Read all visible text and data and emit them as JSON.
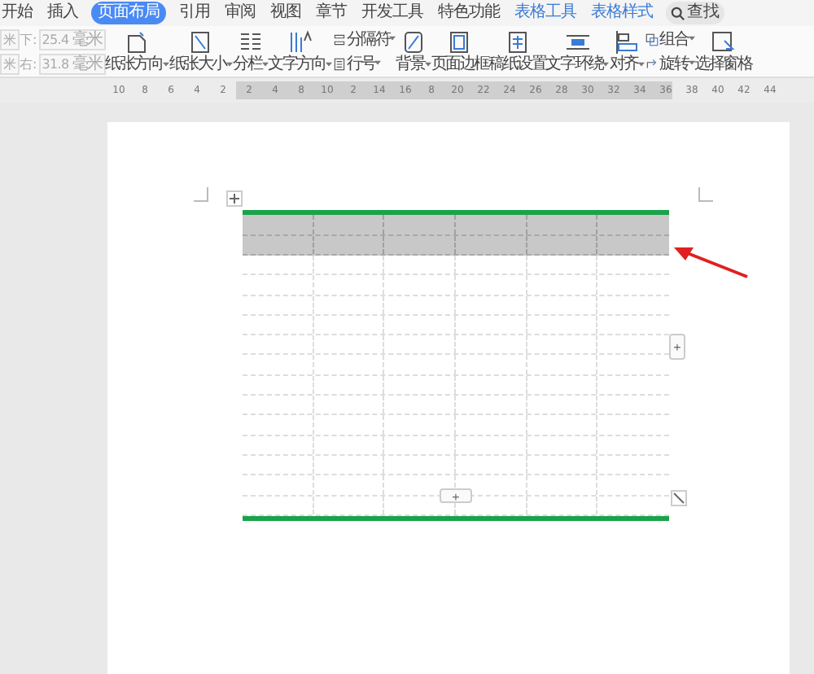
{
  "tabs": [
    {
      "label": "开始",
      "selected": false,
      "kind": "normal"
    },
    {
      "label": "插入",
      "selected": false,
      "kind": "normal"
    },
    {
      "label": "页面布局",
      "selected": true,
      "kind": "normal"
    },
    {
      "label": "引用",
      "selected": false,
      "kind": "normal"
    },
    {
      "label": "审阅",
      "selected": false,
      "kind": "normal"
    },
    {
      "label": "视图",
      "selected": false,
      "kind": "normal"
    },
    {
      "label": "章节",
      "selected": false,
      "kind": "normal"
    },
    {
      "label": "开发工具",
      "selected": false,
      "kind": "normal"
    },
    {
      "label": "特色功能",
      "selected": false,
      "kind": "normal"
    },
    {
      "label": "表格工具",
      "selected": false,
      "kind": "contextual"
    },
    {
      "label": "表格样式",
      "selected": false,
      "kind": "contextual"
    }
  ],
  "search": {
    "label": "查找"
  },
  "margin_fields": [
    {
      "value": "米"
    },
    {
      "value": "米"
    }
  ],
  "margins": [
    {
      "label": "下:",
      "value": "25.4",
      "unit": "毫米"
    },
    {
      "label": "右:",
      "value": "31.8",
      "unit": "毫米"
    }
  ],
  "ribbon": [
    {
      "kind": "big",
      "label": "纸张方向",
      "dropdown": true
    },
    {
      "kind": "big",
      "label": "纸张大小",
      "dropdown": true
    },
    {
      "kind": "big",
      "label": "分栏",
      "dropdown": true
    },
    {
      "kind": "big",
      "label": "文字方向",
      "dropdown": true
    },
    {
      "kind": "small",
      "items": [
        {
          "label": "分隔符",
          "dropdown": true
        },
        {
          "label": "行号",
          "dropdown": true
        }
      ]
    },
    {
      "kind": "big",
      "label": "背景",
      "dropdown": true
    },
    {
      "kind": "big",
      "label": "页面边框",
      "dropdown": false
    },
    {
      "kind": "big",
      "label": "稿纸设置",
      "dropdown": false
    },
    {
      "kind": "big",
      "label": "文字环绕",
      "dropdown": true
    },
    {
      "kind": "big",
      "label": "对齐",
      "dropdown": true
    },
    {
      "kind": "small",
      "items": [
        {
          "label": "组合",
          "dropdown": true
        },
        {
          "label": "旋转",
          "dropdown": true
        }
      ]
    },
    {
      "kind": "big",
      "label": "选择窗格",
      "dropdown": false
    }
  ],
  "ruler": [
    "10",
    "8",
    "6",
    "4",
    "2",
    "2",
    "4",
    "8",
    "10",
    "2",
    "14",
    "16",
    "8",
    "20",
    "22",
    "24",
    "26",
    "28",
    "30",
    "32",
    "34",
    "36",
    "38",
    "40",
    "42",
    "44"
  ],
  "table": {
    "rows": [
      {
        "selected": true
      },
      {
        "selected": true
      },
      {
        "selected": false
      },
      {
        "selected": false
      },
      {
        "selected": false
      },
      {
        "selected": false
      },
      {
        "selected": false
      },
      {
        "selected": false
      },
      {
        "selected": false
      },
      {
        "selected": false
      },
      {
        "selected": false
      },
      {
        "selected": false
      },
      {
        "selected": false
      },
      {
        "selected": false
      },
      {
        "selected": false
      }
    ],
    "add_row": {
      "label": "+"
    },
    "add_column": {
      "label": "+"
    }
  }
}
